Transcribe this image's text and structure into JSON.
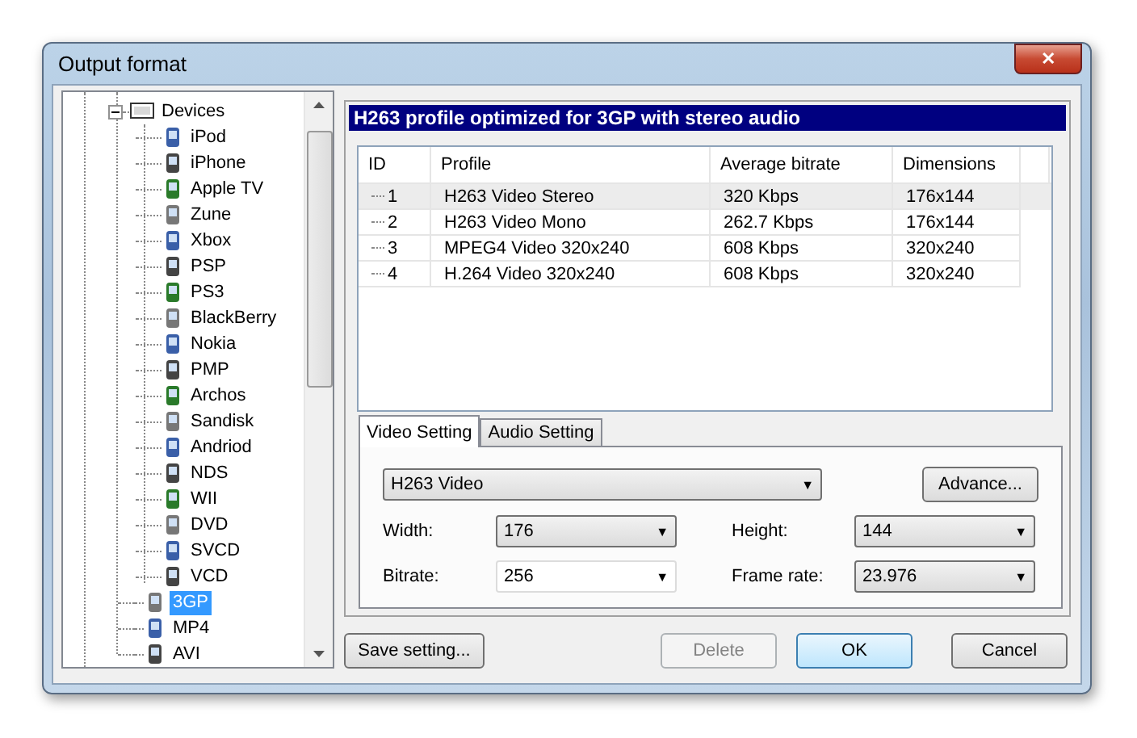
{
  "window": {
    "title": "Output format",
    "close": "✕"
  },
  "tree": {
    "items": [
      {
        "label": "Devices",
        "expanded": true,
        "selected": false,
        "children": [
          {
            "label": "iPod",
            "selected": false
          },
          {
            "label": "iPhone",
            "selected": false
          },
          {
            "label": "Apple TV",
            "selected": false
          },
          {
            "label": "Zune",
            "selected": false
          },
          {
            "label": "Xbox",
            "selected": false
          },
          {
            "label": "PSP",
            "selected": false
          },
          {
            "label": "PS3",
            "selected": false
          },
          {
            "label": "BlackBerry",
            "selected": false
          },
          {
            "label": "Nokia",
            "selected": false
          },
          {
            "label": "PMP",
            "selected": false
          },
          {
            "label": "Archos",
            "selected": false
          },
          {
            "label": "Sandisk",
            "selected": false
          },
          {
            "label": "Andriod",
            "selected": false
          },
          {
            "label": "NDS",
            "selected": false
          },
          {
            "label": "WII",
            "selected": false
          },
          {
            "label": "DVD",
            "selected": false
          },
          {
            "label": "SVCD",
            "selected": false
          },
          {
            "label": "VCD",
            "selected": false
          }
        ]
      },
      {
        "label": "3GP",
        "selected": true
      },
      {
        "label": "MP4",
        "selected": false
      },
      {
        "label": "AVI",
        "selected": false
      }
    ]
  },
  "profile_title": "H263 profile optimized for 3GP with stereo audio",
  "table": {
    "columns": [
      "ID",
      "Profile",
      "Average bitrate",
      "Dimensions"
    ],
    "rows": [
      {
        "cells": [
          "1",
          "H263 Video Stereo",
          "320 Kbps",
          "176x144"
        ],
        "selected": true
      },
      {
        "cells": [
          "2",
          "H263 Video Mono",
          "262.7 Kbps",
          "176x144"
        ],
        "selected": false
      },
      {
        "cells": [
          "3",
          "MPEG4 Video 320x240",
          "608 Kbps",
          "320x240"
        ],
        "selected": false
      },
      {
        "cells": [
          "4",
          "H.264 Video 320x240",
          "608 Kbps",
          "320x240"
        ],
        "selected": false
      }
    ]
  },
  "tabs": [
    {
      "label": "Video Setting",
      "selected": true
    },
    {
      "label": "Audio Setting",
      "selected": false
    }
  ],
  "codec": {
    "value": "H263 Video",
    "caret": "▼"
  },
  "advance_button": "Advance...",
  "fields": [
    {
      "label": "Width:",
      "value": "176",
      "editable": false
    },
    {
      "label": "Height:",
      "value": "144",
      "editable": false
    },
    {
      "label": "Bitrate:",
      "value": "256",
      "editable": true
    },
    {
      "label": "Frame rate:",
      "value": "23.976",
      "editable": false
    }
  ],
  "buttons": [
    {
      "label": "Save setting...",
      "disabled": false,
      "default": false
    },
    {
      "label": "Delete",
      "disabled": true,
      "default": false
    },
    {
      "label": "OK",
      "disabled": false,
      "default": true
    },
    {
      "label": "Cancel",
      "disabled": false,
      "default": false
    }
  ]
}
